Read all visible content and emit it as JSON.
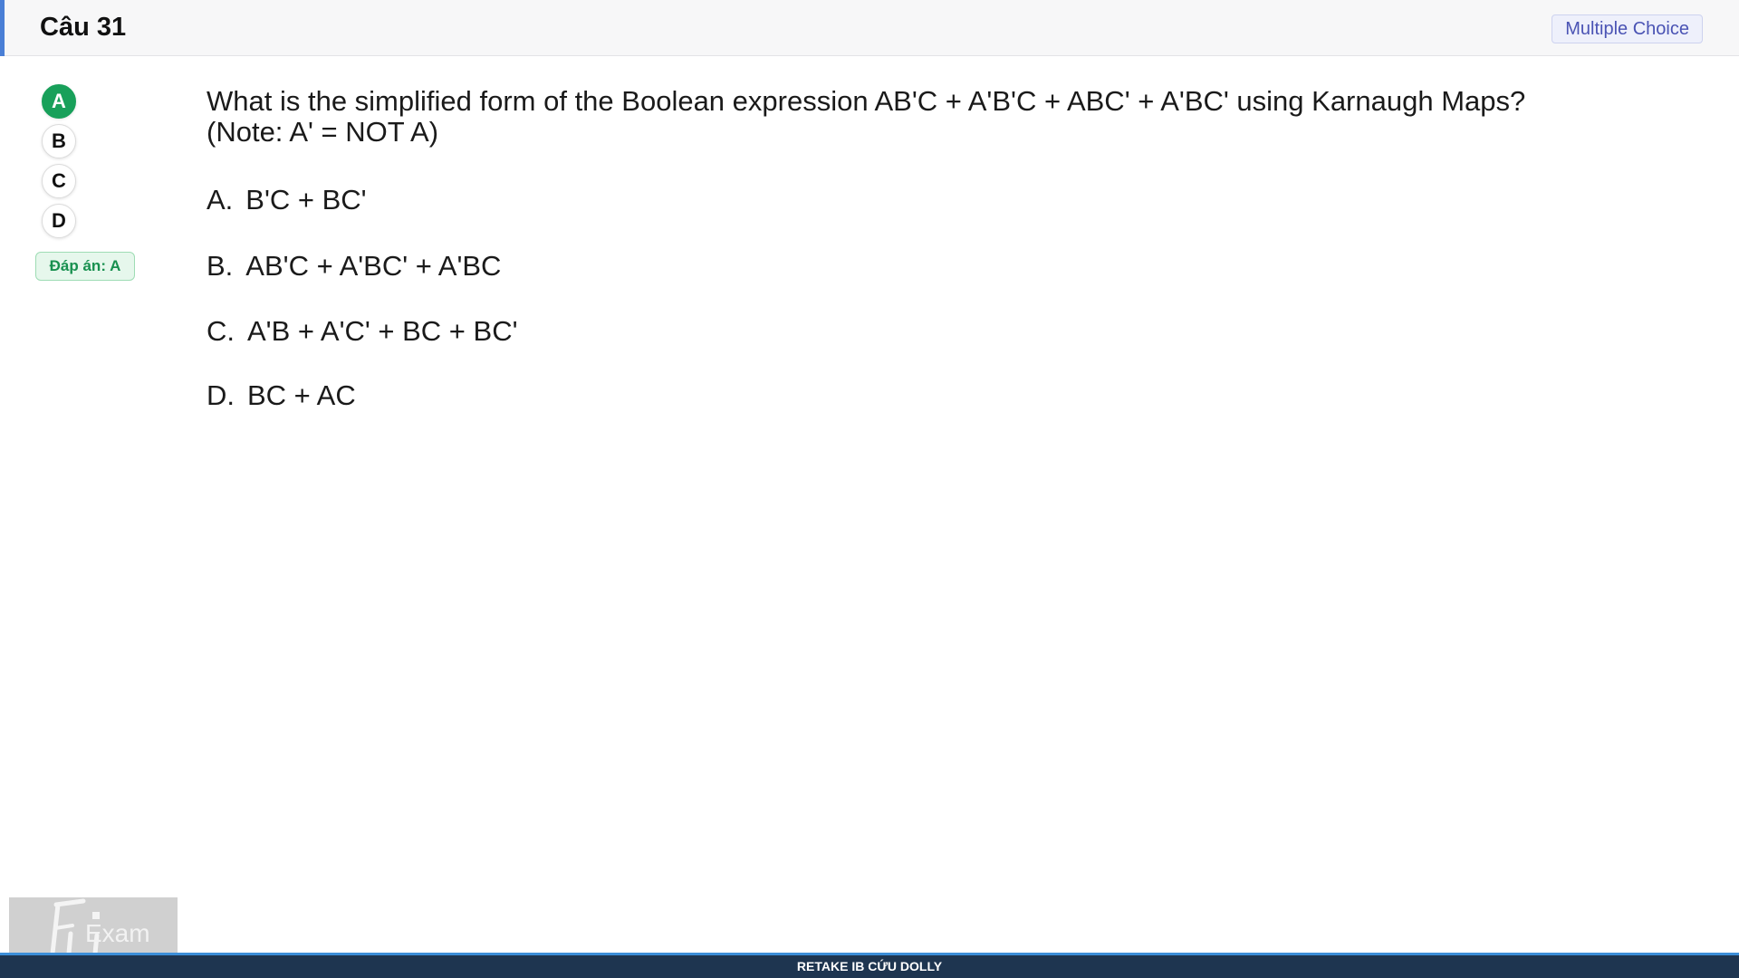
{
  "header": {
    "title": "Câu 31",
    "type_label": "Multiple Choice"
  },
  "selector": {
    "options": [
      "A",
      "B",
      "C",
      "D"
    ],
    "selected": "A",
    "answer_label": "Đáp án: A"
  },
  "question": {
    "text_line1": "What is the simplified form of the Boolean expression AB'C + A'B'C + ABC' + A'BC' using Karnaugh Maps?",
    "text_line2": "(Note: A' = NOT A)",
    "choices": [
      {
        "letter": "A.",
        "text": "B'C + BC'"
      },
      {
        "letter": "B.",
        "text": "AB'C + A'BC' + A'BC"
      },
      {
        "letter": "C.",
        "text": "A'B + A'C' + BC + BC'"
      },
      {
        "letter": "D.",
        "text": "BC + AC"
      }
    ]
  },
  "logo": {
    "text": "Exam"
  },
  "footer": {
    "text": "RETAKE IB CỨU DOLLY"
  },
  "colors": {
    "accent": "#4a7fd6",
    "selected": "#18a05a",
    "badge_text": "#4a53b4",
    "footer_bg": "#1e3550"
  }
}
